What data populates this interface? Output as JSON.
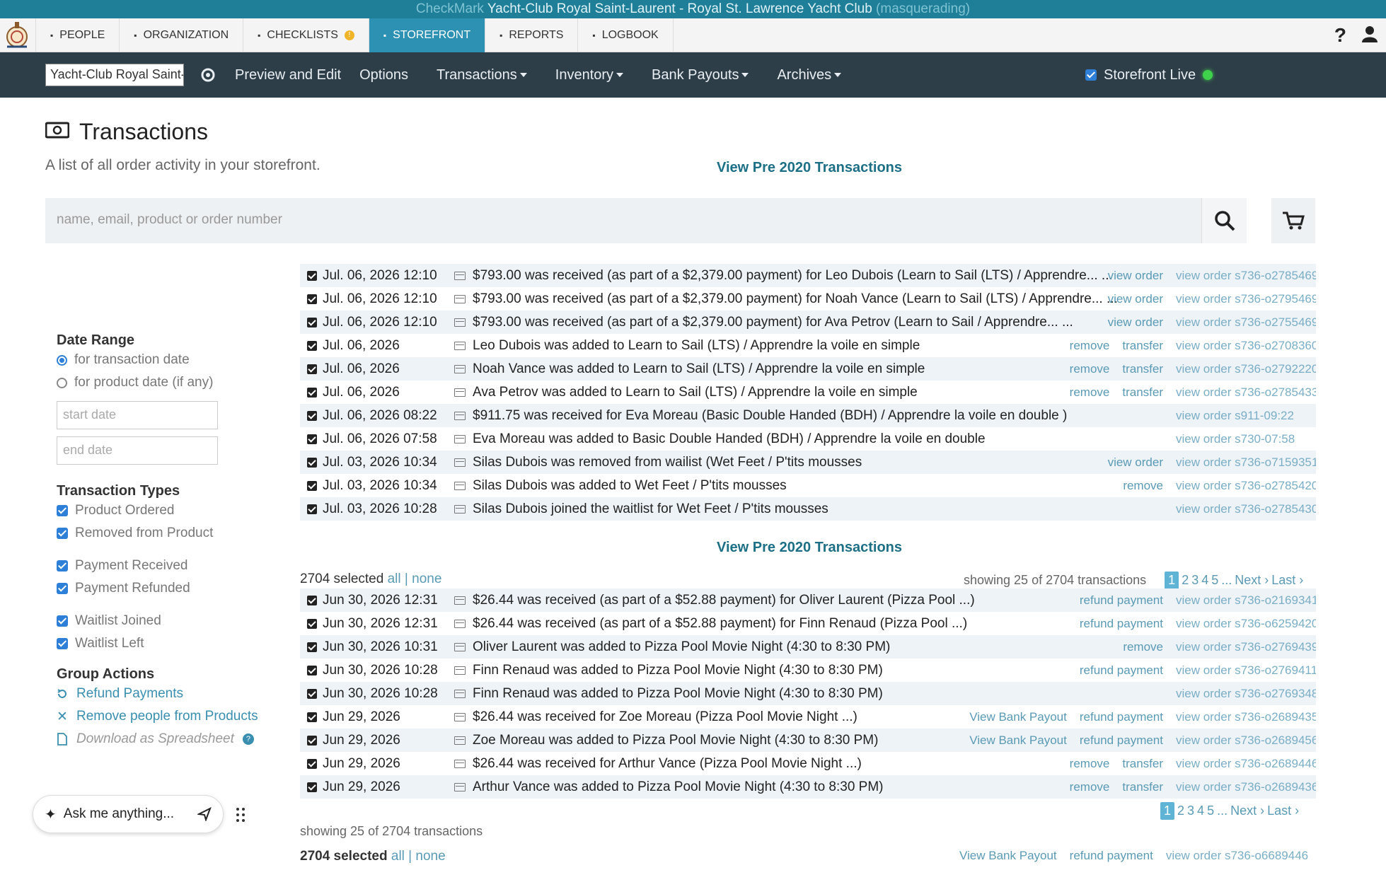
{
  "window": {
    "title_dim": "CheckMark",
    "title": "Yacht-Club Royal Saint-Laurent - Royal St. Lawrence Yacht Club",
    "title_tail": "(masquerading)"
  },
  "topnav": {
    "tabs": [
      {
        "label": "People",
        "icon": "people-icon"
      },
      {
        "label": "Organization",
        "icon": "organization-icon"
      },
      {
        "label": "Checklists",
        "icon": "checklist-icon",
        "badge": "!"
      },
      {
        "label": "Storefront",
        "icon": "storefront-icon",
        "active": true
      },
      {
        "label": "Reports",
        "icon": "chart-icon"
      },
      {
        "label": "Logbook",
        "icon": "book-icon"
      }
    ],
    "help": "?"
  },
  "subnav": {
    "store_name": "Yacht-Club Royal Saint-Laurent",
    "preview": "Preview and Edit",
    "options": "Options",
    "transactions": "Transactions",
    "inventory": "Inventory",
    "bank_payouts": "Bank Payouts",
    "archives": "Archives",
    "live": "Storefront Live"
  },
  "page": {
    "title": "Transactions",
    "subtitle": "A list of all order activity in your storefront.",
    "pre2020": "View Pre 2020 Transactions",
    "search_placeholder": "name, email, product or order number"
  },
  "sidebar": {
    "date_range": "Date Range",
    "for_transaction": "for transaction date",
    "for_product": "for product date (if any)",
    "start_date": "start date",
    "end_date": "end date",
    "types_title": "Transaction Types",
    "types": [
      "Product Ordered",
      "Removed from Product",
      "Payment Received",
      "Payment Refunded",
      "Waitlist Joined",
      "Waitlist Left"
    ],
    "group_title": "Group Actions",
    "refund": "Refund Payments",
    "remove_people": "Remove people from Products",
    "download": "Download as Spreadsheet"
  },
  "ask": {
    "placeholder": "Ask me anything..."
  },
  "rows_recent": [
    {
      "date": "Jul. 06, 2026 12:10",
      "desc": "$793.00 was received (as part of a $2,379.00 payment) for Leo Dubois (Learn to Sail (LTS) / Apprendre... ...",
      "links": [
        "view order"
      ],
      "order": "view order s736-o2785469"
    },
    {
      "date": "Jul. 06, 2026 12:10",
      "desc": "$793.00 was received (as part of a $2,379.00 payment) for Noah Vance (Learn to Sail (LTS) / Apprendre... ...",
      "links": [
        "view order"
      ],
      "order": "view order s736-o2795469"
    },
    {
      "date": "Jul. 06, 2026 12:10",
      "desc": "$793.00 was received (as part of a $2,379.00 payment) for Ava Petrov (Learn to Sail / Apprendre... ...",
      "links": [
        "view order"
      ],
      "order": "view order s736-o2755469"
    },
    {
      "date": "Jul. 06, 2026",
      "desc": "Leo Dubois was added to Learn to Sail (LTS) / Apprendre la voile en simple",
      "links": [
        "remove",
        "transfer"
      ],
      "order": "view order s736-o2708360"
    },
    {
      "date": "Jul. 06, 2026",
      "desc": "Noah Vance was added to Learn to Sail (LTS) / Apprendre la voile en simple",
      "links": [
        "remove",
        "transfer"
      ],
      "order": "view order s736-o2792220"
    },
    {
      "date": "Jul. 06, 2026",
      "desc": "Ava Petrov was added to Learn to Sail (LTS) / Apprendre la voile en simple",
      "links": [
        "remove",
        "transfer"
      ],
      "order": "view order s736-o2785433"
    },
    {
      "date": "Jul. 06, 2026 08:22",
      "desc": "$911.75 was received for Eva Moreau (Basic Double Handed (BDH) / Apprendre la voile en double )",
      "links": [],
      "order": "view order s911-09:22"
    },
    {
      "date": "Jul. 06, 2026 07:58",
      "desc": "Eva Moreau was added to Basic Double Handed (BDH) / Apprendre la voile en double",
      "links": [],
      "order": "view order s730-07:58"
    },
    {
      "date": "Jul. 03, 2026 10:34",
      "desc": "Silas Dubois was removed from wailist (Wet Feet / P'tits mousses",
      "links": [
        "view order"
      ],
      "order": "view order s736-o7159351"
    },
    {
      "date": "Jul. 03, 2026 10:34",
      "desc": "Silas Dubois was added to Wet Feet / P'tits mousses",
      "links": [
        "remove"
      ],
      "order": "view order s736-o2785420"
    },
    {
      "date": "Jul. 03, 2026 10:28",
      "desc": "Silas Dubois joined the waitlist for Wet Feet / P'tits mousses",
      "links": [],
      "order": "view order s736-o2785430"
    }
  ],
  "selection": {
    "count": "2704 selected",
    "all": "all",
    "sep": "|",
    "none": "none",
    "showing": "showing 25 of 2704 transactions",
    "pages": [
      "1",
      "2",
      "3",
      "4",
      "5"
    ],
    "ellipsis": "...",
    "next": "Next ›",
    "last": "Last ›"
  },
  "rows_older": [
    {
      "date": "Jun 30, 2026 12:31",
      "desc": "$26.44 was received (as part of a $52.88 payment) for Oliver Laurent (Pizza Pool ...)",
      "links": [
        "refund payment"
      ],
      "order": "view order s736-o2169341"
    },
    {
      "date": "Jun 30, 2026 12:31",
      "desc": "$26.44 was received (as part of a $52.88 payment) for Finn Renaud (Pizza Pool ...)",
      "links": [
        "refund payment"
      ],
      "order": "view order s736-o6259420"
    },
    {
      "date": "Jun 30, 2026 10:31",
      "desc": "Oliver Laurent was added to Pizza Pool Movie Night (4:30 to 8:30 PM)",
      "links": [
        "remove"
      ],
      "order": "view order s736-o2769439"
    },
    {
      "date": "Jun 30, 2026 10:28",
      "desc": "Finn Renaud was added to Pizza Pool Movie Night (4:30 to 8:30 PM)",
      "links": [
        "refund payment"
      ],
      "order": "view order s736-o2769411"
    },
    {
      "date": "Jun 30, 2026 10:28",
      "desc": "Finn Renaud was added to Pizza Pool Movie Night (4:30 to 8:30 PM)",
      "links": [],
      "order": "view order s736-o2769348"
    },
    {
      "date": "Jun 29, 2026",
      "desc": "$26.44 was received for Zoe Moreau (Pizza Pool Movie Night ...)",
      "links": [
        "View Bank Payout",
        "refund payment"
      ],
      "order": "view order s736-o2689435"
    },
    {
      "date": "Jun 29, 2026",
      "desc": "Zoe Moreau was added to Pizza Pool Movie Night (4:30 to 8:30 PM)",
      "links": [
        "View Bank Payout",
        "refund payment"
      ],
      "order": "view order s736-o2689456"
    },
    {
      "date": "Jun 29, 2026",
      "desc": "$26.44 was received for Arthur Vance (Pizza Pool Movie Night ...)",
      "links": [
        "remove",
        "transfer"
      ],
      "order": "view order s736-o2689446"
    },
    {
      "date": "Jun 29, 2026",
      "desc": "Arthur Vance was added to Pizza Pool Movie Night (4:30 to 8:30 PM)",
      "links": [
        "remove",
        "transfer"
      ],
      "order": "view order s736-o2689436"
    }
  ],
  "bottom_links": [
    "View Bank Payout",
    "refund payment"
  ],
  "bottom_order": "view order s736-o6689446"
}
